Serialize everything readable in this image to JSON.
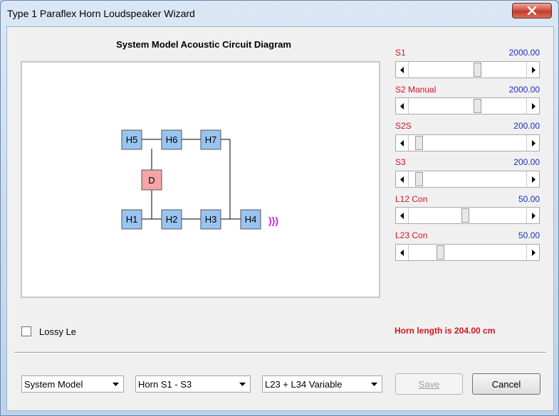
{
  "window": {
    "title": "Type 1 Paraflex Horn Loudspeaker Wizard"
  },
  "diagram": {
    "title": "System Model Acoustic Circuit Diagram",
    "nodes": {
      "h5": "H5",
      "h6": "H6",
      "h7": "H7",
      "d": "D",
      "h1": "H1",
      "h2": "H2",
      "h3": "H3",
      "h4": "H4"
    },
    "sound_symbol": ")))",
    "colors": {
      "horn_box": "#99c4f0",
      "driver_box": "#f4a6a6",
      "sound": "#cc22cc"
    }
  },
  "sliders": [
    {
      "label": "S1",
      "value": "2000.00",
      "level": 0.59
    },
    {
      "label": "S2  Manual",
      "value": "2000.00",
      "level": 0.59
    },
    {
      "label": "S2S",
      "value": "200.00",
      "level": 0.05
    },
    {
      "label": "S3",
      "value": "200.00",
      "level": 0.05
    },
    {
      "label": "L12  Con",
      "value": "50.00",
      "level": 0.48
    },
    {
      "label": "L23  Con",
      "value": "50.00",
      "level": 0.25
    }
  ],
  "options": {
    "lossy_label": "Lossy Le",
    "lossy_checked": false
  },
  "status": {
    "horn_length": "Horn length is 204.00 cm"
  },
  "footer": {
    "model_select": "System Model",
    "horn_select": "Horn S1 - S3",
    "variable_select": "L23 + L34 Variable",
    "save_label": "Save",
    "cancel_label": "Cancel"
  },
  "colors": {
    "label_red": "#d4141e",
    "value_blue": "#1e2ebc"
  }
}
